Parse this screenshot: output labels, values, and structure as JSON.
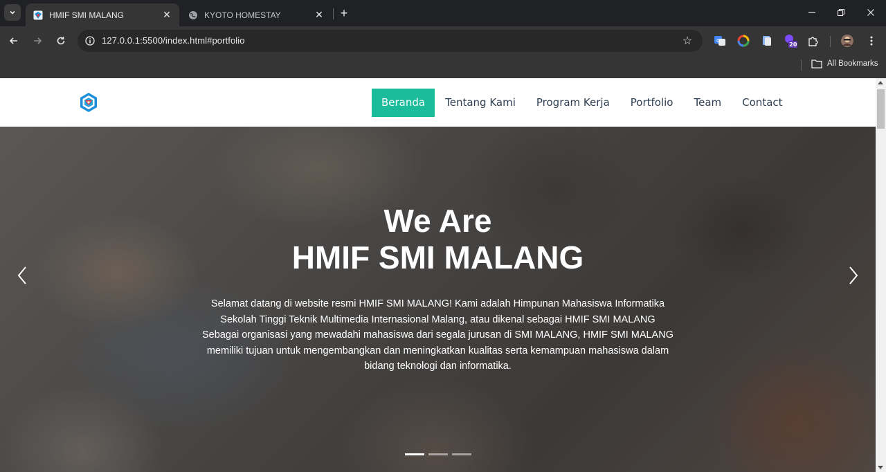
{
  "browser": {
    "tabs": [
      {
        "title": "HMIF SMI MALANG",
        "active": true
      },
      {
        "title": "KYOTO HOMESTAY",
        "active": false
      }
    ],
    "url": "127.0.0.1:5500/index.html#portfolio",
    "bookmarks_label": "All Bookmarks",
    "extension_badge": "20"
  },
  "site": {
    "nav": [
      {
        "label": "Beranda",
        "active": true
      },
      {
        "label": "Tentang Kami",
        "active": false
      },
      {
        "label": "Program Kerja",
        "active": false
      },
      {
        "label": "Portfolio",
        "active": false
      },
      {
        "label": "Team",
        "active": false
      },
      {
        "label": "Contact",
        "active": false
      }
    ],
    "accent_color": "#1bbc9b",
    "hero": {
      "title_line1": "We Are",
      "title_line2": "HMIF SMI MALANG",
      "description": "Selamat datang di website resmi HMIF SMI MALANG! Kami adalah Himpunan Mahasiswa Informatika Sekolah Tinggi Teknik Multimedia Internasional Malang, atau dikenal sebagai HMIF SMI MALANG Sebagai organisasi yang mewadahi mahasiswa dari segala jurusan di SMI MALANG, HMIF SMI MALANG memiliki tujuan untuk mengembangkan dan meningkatkan kualitas serta kemampuan mahasiswa dalam bidang teknologi dan informatika.",
      "slides": 3,
      "active_slide": 1
    }
  }
}
